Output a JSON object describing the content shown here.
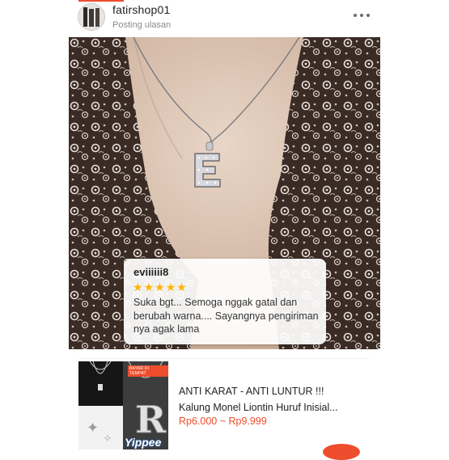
{
  "header": {
    "username": "fatirshop01",
    "subtitle": "Posting ulasan",
    "more_icon": "more-dots-icon",
    "accent": "#ee4d2d"
  },
  "review": {
    "reviewer": "eviiiiii8",
    "rating": 5,
    "star_color": "#ffb400",
    "text": "Suka bgt... Semoga nggak gatal dan berubah warna.... Sayangnya pengiriman nya agak lama"
  },
  "product": {
    "title_line1": "ANTI KARAT - ANTI LUNTUR !!!",
    "title_line2": "Kalung Monel Liontin Huruf Inisial...",
    "price": "Rp6.000 ~ Rp9.999",
    "badge": "BAYAR DI TEMPAT",
    "brand": "Yippee",
    "price_color": "#ee4d2d"
  }
}
